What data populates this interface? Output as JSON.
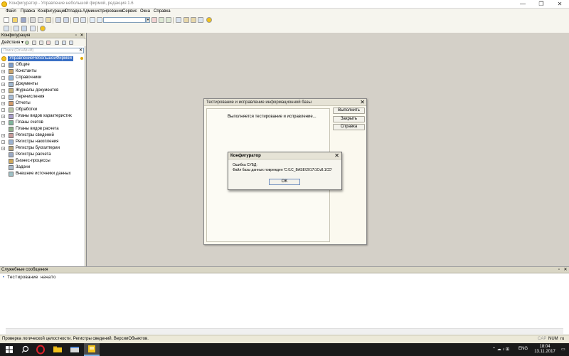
{
  "window": {
    "title": "Конфигуратор - Управление небольшой фирмой, редакция 1.6",
    "minimize_glyph": "—",
    "maximize_glyph": "❐",
    "close_glyph": "✕"
  },
  "menu": [
    "Файл",
    "Правка",
    "Конфигурация",
    "Отладка",
    "Администрирование",
    "Сервис",
    "Окна",
    "Справка"
  ],
  "left_panel": {
    "caption": "Конфигурация",
    "pin_glyph": "▫",
    "close_glyph": "✕",
    "actions_label": "Действия ▾",
    "search_placeholder": "Поиск (Ctrl+Alt+M)",
    "search_clear": "✕",
    "root": "УправлениеНебольшойФирмой",
    "items": [
      {
        "label": "Общие",
        "icon": "gear-folder-icon",
        "expandable": true
      },
      {
        "label": "Константы",
        "icon": "constants-icon",
        "expandable": true
      },
      {
        "label": "Справочники",
        "icon": "catalogs-icon",
        "expandable": true
      },
      {
        "label": "Документы",
        "icon": "documents-icon",
        "expandable": true
      },
      {
        "label": "Журналы документов",
        "icon": "journals-icon",
        "expandable": true
      },
      {
        "label": "Перечисления",
        "icon": "enums-icon",
        "expandable": true
      },
      {
        "label": "Отчеты",
        "icon": "reports-icon",
        "expandable": true
      },
      {
        "label": "Обработки",
        "icon": "processing-icon",
        "expandable": true
      },
      {
        "label": "Планы видов характеристик",
        "icon": "characteristics-icon",
        "expandable": true
      },
      {
        "label": "Планы счетов",
        "icon": "chart-of-accounts-icon",
        "expandable": true
      },
      {
        "label": "Планы видов расчета",
        "icon": "calc-types-icon",
        "expandable": false
      },
      {
        "label": "Регистры сведений",
        "icon": "info-registers-icon",
        "expandable": true
      },
      {
        "label": "Регистры накопления",
        "icon": "accum-registers-icon",
        "expandable": true
      },
      {
        "label": "Регистры бухгалтерии",
        "icon": "accounting-registers-icon",
        "expandable": true
      },
      {
        "label": "Регистры расчета",
        "icon": "calc-registers-icon",
        "expandable": false
      },
      {
        "label": "Бизнес-процессы",
        "icon": "business-process-icon",
        "expandable": false
      },
      {
        "label": "Задачи",
        "icon": "tasks-icon",
        "expandable": false
      },
      {
        "label": "Внешние источники данных",
        "icon": "external-sources-icon",
        "expandable": false
      }
    ]
  },
  "test_dialog": {
    "title": "Тестирование и исправление информационной базы",
    "close_glyph": "✕",
    "status": "Выполняется тестирование и исправление...",
    "buttons": {
      "run": "Выполнить",
      "close": "Закрыть",
      "help": "Справка"
    }
  },
  "error_dialog": {
    "title": "Конфигуратор",
    "close_glyph": "✕",
    "line1": "Ошибка СУБД:",
    "line2": "Файл базы данных поврежден 'C:\\1C_BASE\\2017\\1Cv8.1CD'",
    "ok": "OK"
  },
  "messages_panel": {
    "caption": "Служебные сообщения",
    "pin_glyph": "▫",
    "close_glyph": "✕",
    "line": "Тестирование начато"
  },
  "statusbar": {
    "text": "Проверка логической целостности. Регистры сведений. ВерсииОбъектов.",
    "cap": "CAP",
    "num": "NUM",
    "lang": "ru"
  },
  "taskbar": {
    "lang": "ENG",
    "time": "18:04",
    "date": "13.11.2017",
    "tray_glyphs": "⌃  ☁  ♪  ⊞"
  },
  "colors": {
    "root_highlight": "#3a6fc5",
    "workspace": "#d4d0c8",
    "taskbar": "#1a1a1a"
  }
}
